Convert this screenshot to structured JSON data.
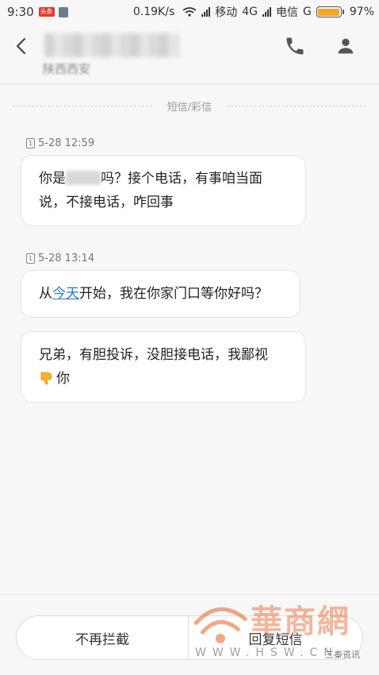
{
  "status_bar": {
    "time": "9:30",
    "news_badge": "头条",
    "network_speed": "0.19K/s",
    "carrier1": "移动",
    "network_type": "4G",
    "carrier2": "电信",
    "carrier2_type": "G",
    "battery_percent": "97%",
    "battery_level": 0.97
  },
  "header": {
    "contact_sub": "陕西西安"
  },
  "thread": {
    "divider_label": "短信/彩信",
    "groups": [
      {
        "sim": "1",
        "timestamp": "5-28 12:59",
        "messages": [
          {
            "line1_a": "你是",
            "line1_b": "吗？接个电话，有事咱当面",
            "line2": "说，不接电话，咋回事"
          }
        ]
      },
      {
        "sim": "1",
        "timestamp": "5-28 13:14",
        "messages": [
          {
            "prefix": "从",
            "link": "今天",
            "suffix": "开始，我在你家门口等你好吗？"
          },
          {
            "line1": "兄弟，有胆投诉，没胆接电话，我鄙视",
            "line2": "你"
          }
        ]
      }
    ]
  },
  "bottom_bar": {
    "left_button": "不再拦截",
    "right_button": "回复短信"
  },
  "watermark": {
    "logo_text": "華商網",
    "url": "WWW.HSW.CN",
    "wechat": "三秦资讯"
  },
  "colors": {
    "link": "#2d78c2",
    "battery": "#f1a627",
    "watermark": "#e4622a"
  }
}
